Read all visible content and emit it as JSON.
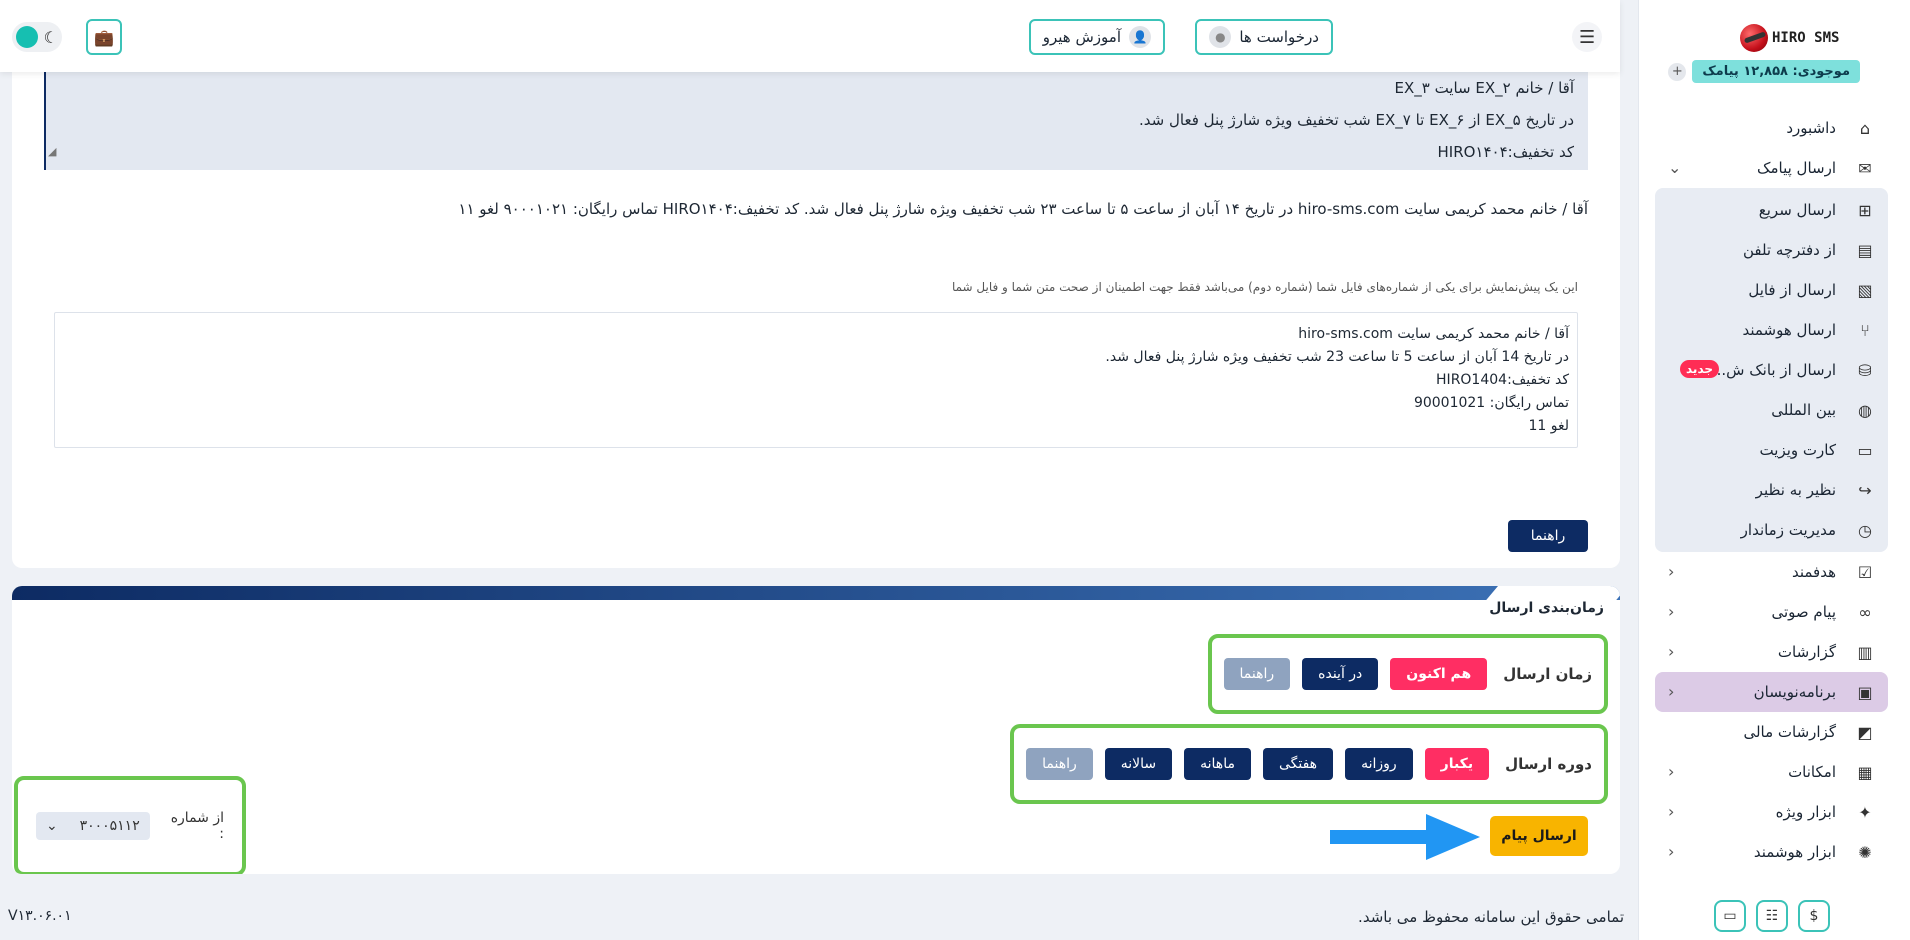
{
  "sidebar": {
    "logo_text": "HIRO SMS",
    "balance": "موجودی: ۱۲,۸۵۸ پیامک",
    "items": [
      {
        "label": "داشبورد",
        "icon": "home-icon"
      },
      {
        "label": "ارسال پیامک",
        "icon": "sms-icon",
        "chevron": "⌄"
      },
      {
        "label": "ارسال سریع",
        "icon": "plus-message-icon"
      },
      {
        "label": "از دفترچه تلفن",
        "icon": "phonebook-icon"
      },
      {
        "label": "ارسال از فایل",
        "icon": "excel-file-icon"
      },
      {
        "label": "ارسال هوشمند",
        "icon": "branch-icon"
      },
      {
        "label": "ارسال از بانک ش...",
        "icon": "database-icon",
        "badge": "جدید"
      },
      {
        "label": "بین المللی",
        "icon": "globe-icon"
      },
      {
        "label": "کارت ویزیت",
        "icon": "id-card-icon"
      },
      {
        "label": "نظیر به نظیر",
        "icon": "share-icon"
      },
      {
        "label": "مدیریت زماندار",
        "icon": "clock-icon"
      },
      {
        "label": "هدفمند",
        "icon": "check-message-icon"
      },
      {
        "label": "پیام صوتی",
        "icon": "voicemail-icon"
      },
      {
        "label": "گزارشات",
        "icon": "report-icon"
      },
      {
        "label": "برنامه‌نویسان",
        "icon": "developer-icon"
      },
      {
        "label": "گزارشات مالی",
        "icon": "finance-chart-icon"
      },
      {
        "label": "امکانات",
        "icon": "features-icon"
      },
      {
        "label": "ابزار ویژه",
        "icon": "sparkle-icon"
      },
      {
        "label": "ابزار هوشمند",
        "icon": "bulb-icon"
      }
    ]
  },
  "topbar": {
    "requests_label": "درخواست ها",
    "training_label": "آموزش هیرو"
  },
  "template": {
    "line1": "آقا / خانم  EX_۲ سایت EX_۳",
    "line2": "در تاریخ EX_۵ از EX_۶ تا EX_۷ شب تخفیف ویژه شارژ پنل فعال شد.",
    "line3": "کد تخفیف:HIRO۱۴۰۴"
  },
  "preview_line": "آقا / خانم محمد کریمی سایت hiro-sms.com در تاریخ ۱۴ آبان از ساعت ۵ تا ساعت ۲۳ شب تخفیف ویژه شارژ پنل فعال شد. کد تخفیف:HIRO۱۴۰۴ تماس رایگان: ۹۰۰۰۱۰۲۱ لغو ۱۱",
  "preview_note": "این یک پیش‌نمایش برای یکی از شماره‌های فایل شما (شماره دوم) می‌باشد فقط جهت اطمینان از صحت متن شما و فایل شما",
  "sample": {
    "l1": "آقا / خانم  محمد کریمی سایت hiro-sms.com",
    "l2": "در تاریخ 14 آبان  از ساعت 5 تا ساعت 23 شب تخفیف ویژه شارژ پنل فعال شد.",
    "l3": "کد تخفیف:HIRO1404",
    "l4": "تماس رایگان: 90001021",
    "l5": "لغو 11"
  },
  "help_label": "راهنما",
  "schedule": {
    "title": "زمان‌بندی ارسال",
    "time_label": "زمان ارسال",
    "time_now": "هم اکنون",
    "time_future": "در آینده",
    "time_help": "راهنما",
    "period_label": "دوره ارسال",
    "once": "یکبار",
    "daily": "روزانه",
    "weekly": "هفتگی",
    "monthly": "ماهانه",
    "yearly": "سالانه",
    "period_help": "راهنما",
    "send_label": "ارسال پیام",
    "from_label": "از شماره :",
    "from_value": "۳۰۰۰۵۱۱۲"
  },
  "footer": {
    "copyright": "تمامی حقوق این سامانه محفوظ می باشد.",
    "version": "V۱۳.۰۶.۰۱"
  },
  "colors": {
    "accent": "#3bc3b8",
    "navy": "#0d2b63",
    "pink": "#ff2e63",
    "green_outline": "#6ac64e",
    "send": "#f8b400"
  }
}
